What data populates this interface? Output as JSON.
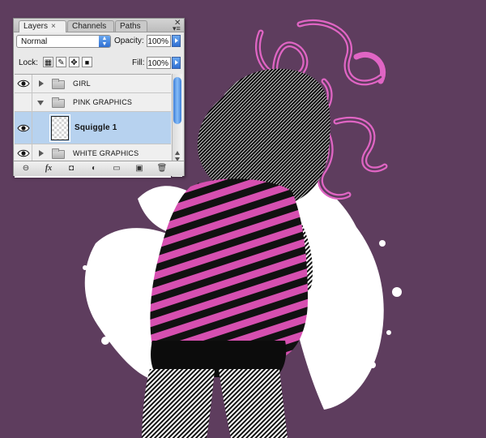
{
  "palette": {
    "tabs": [
      {
        "label": "Layers",
        "active": true
      },
      {
        "label": "Channels",
        "active": false
      },
      {
        "label": "Paths",
        "active": false
      }
    ],
    "close_glyph": "×",
    "blend_mode": "Normal",
    "opacity_label": "Opacity:",
    "opacity_value": "100%",
    "lock_label": "Lock:",
    "fill_label": "Fill:",
    "fill_value": "100%",
    "lock_icons": [
      "lock-transparent-icon",
      "lock-image-icon",
      "lock-position-icon",
      "lock-all-icon"
    ],
    "layers": [
      {
        "name": "GIRL",
        "type": "group",
        "expanded": false,
        "visible": true,
        "selected": false
      },
      {
        "name": "PINK GRAPHICS",
        "type": "group",
        "expanded": true,
        "visible": false,
        "selected": false
      },
      {
        "name": "Squiggle 1",
        "type": "layer",
        "visible": true,
        "selected": true
      },
      {
        "name": "WHITE GRAPHICS",
        "type": "group",
        "expanded": false,
        "visible": true,
        "selected": false
      }
    ],
    "bottom_buttons": [
      {
        "icon": "link-layers-icon",
        "glyph": "⊖"
      },
      {
        "icon": "layer-style-icon",
        "glyph": "fx"
      },
      {
        "icon": "layer-mask-icon",
        "glyph": "◘"
      },
      {
        "icon": "adjustment-layer-icon",
        "glyph": "◐"
      },
      {
        "icon": "new-group-icon",
        "glyph": "▭"
      },
      {
        "icon": "new-layer-icon",
        "glyph": "▣"
      },
      {
        "icon": "trash-icon",
        "glyph": "🗑"
      }
    ]
  },
  "canvas": {
    "background_color": "#5e3d5e",
    "shirt_stripe_color": "#d64fb0",
    "squiggle_color": "#e065c4",
    "splatter_color": "#ffffff"
  }
}
